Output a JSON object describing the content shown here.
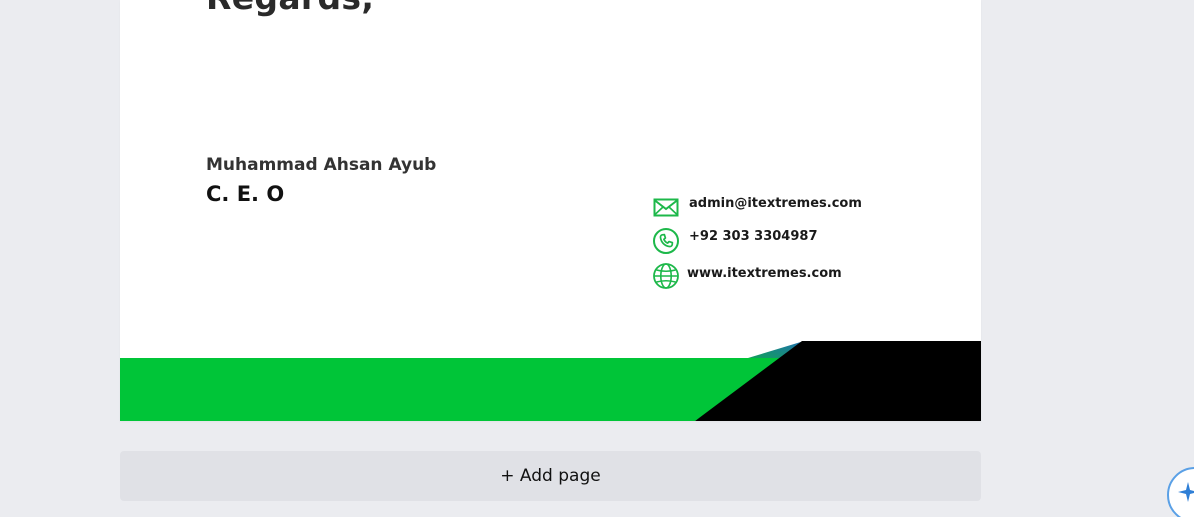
{
  "letter": {
    "closing": "Regards,",
    "signer_name": "Muhammad Ahsan Ayub",
    "signer_title": "C. E. O"
  },
  "contacts": {
    "email": {
      "icon": "mail-icon",
      "text": "admin@itextremes.com"
    },
    "phone": {
      "icon": "phone-icon",
      "text": "+92 303 3304987"
    },
    "website": {
      "icon": "globe-icon",
      "text": "www.itextremes.com"
    }
  },
  "add_page": {
    "label": "+ Add page"
  },
  "assistant": {
    "icon": "sparkle-icon"
  },
  "colors": {
    "background": "#ebecf0",
    "brand_green": "#00c538",
    "footer_black": "#000000",
    "accent_teal": "#1a7fa0",
    "icon_green": "#1db84a",
    "button_bg": "#e0e1e6"
  }
}
